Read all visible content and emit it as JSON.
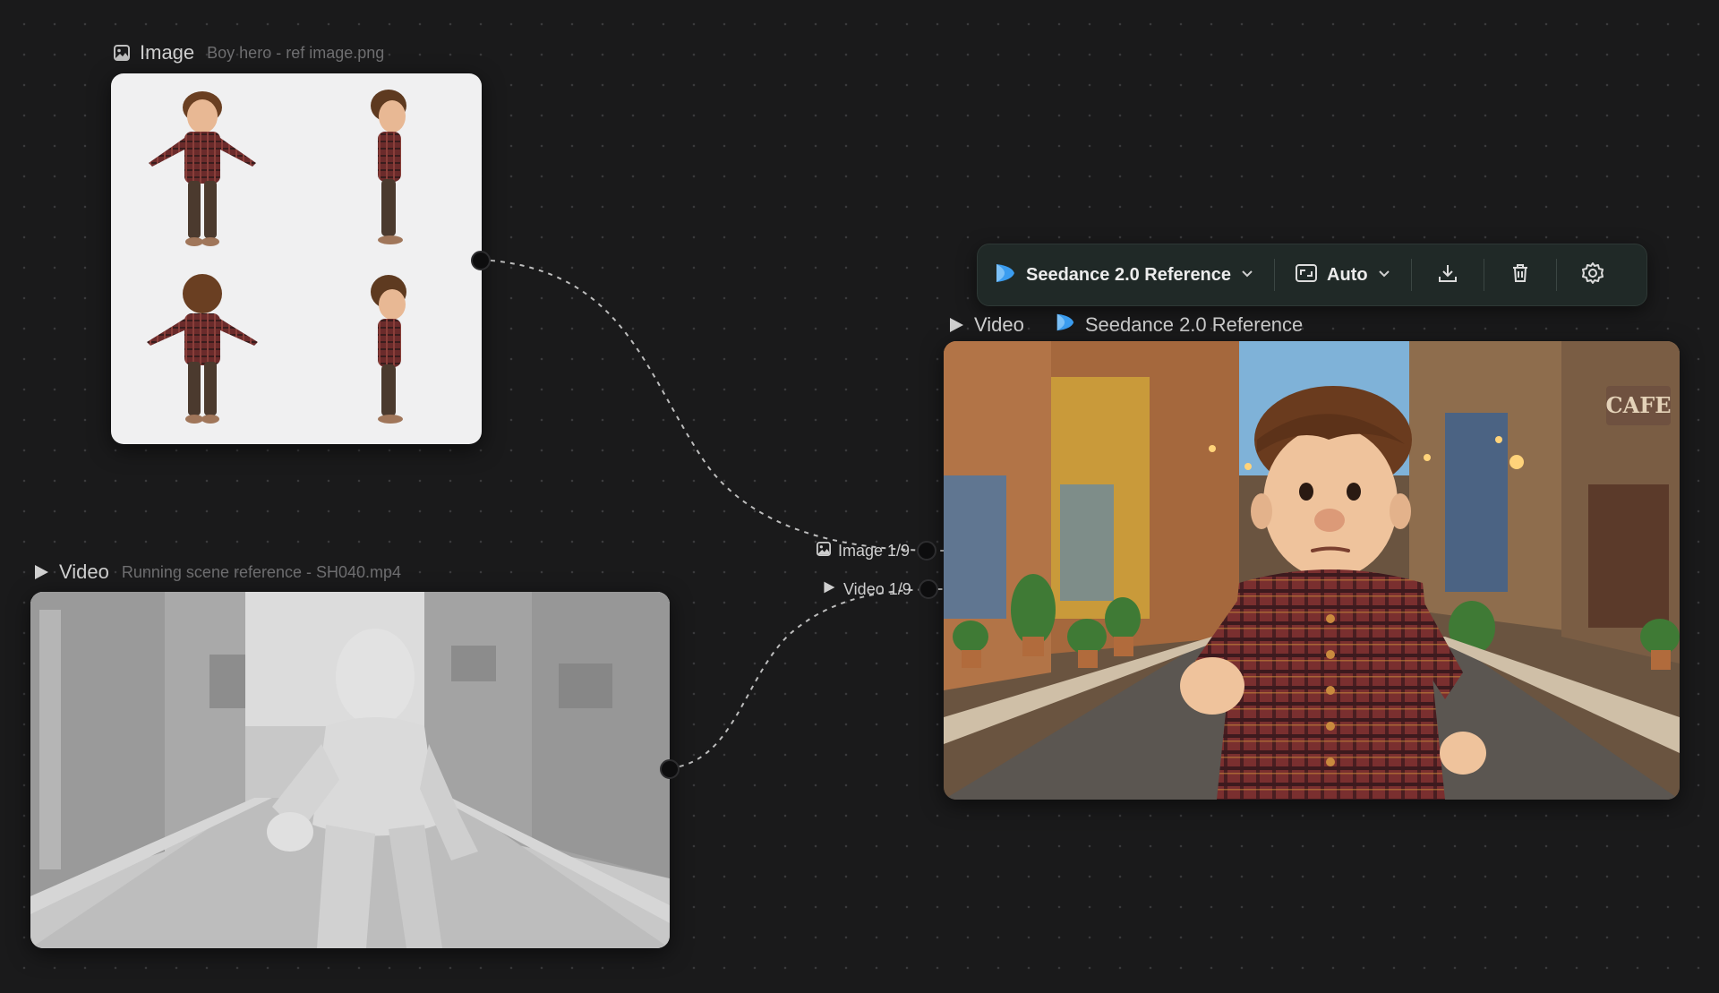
{
  "canvas": {
    "background": "#1a1a1b",
    "accent": "#3b9df0"
  },
  "image_node": {
    "type_label": "Image",
    "file_name": "Boy hero - ref image.png",
    "icon": "image-icon"
  },
  "video_node": {
    "type_label": "Video",
    "file_name": "Running scene reference - SH040.mp4",
    "icon": "play-icon"
  },
  "output_node": {
    "type_label": "Video",
    "model_name": "Seedance 2.0 Reference",
    "icon": "play-icon",
    "model_icon": "seedance-logo-icon",
    "inputs": [
      {
        "label": "Image 1/9",
        "icon": "image-icon"
      },
      {
        "label": "Video 1/9",
        "icon": "play-icon"
      }
    ],
    "sign_text": "CAFE"
  },
  "toolbar": {
    "model_select": "Seedance 2.0 Reference",
    "aspect_select": "Auto",
    "icons": [
      "seedance-logo-icon",
      "chevron-down-icon",
      "aspect-ratio-icon",
      "download-icon",
      "trash-icon",
      "gear-icon"
    ]
  }
}
